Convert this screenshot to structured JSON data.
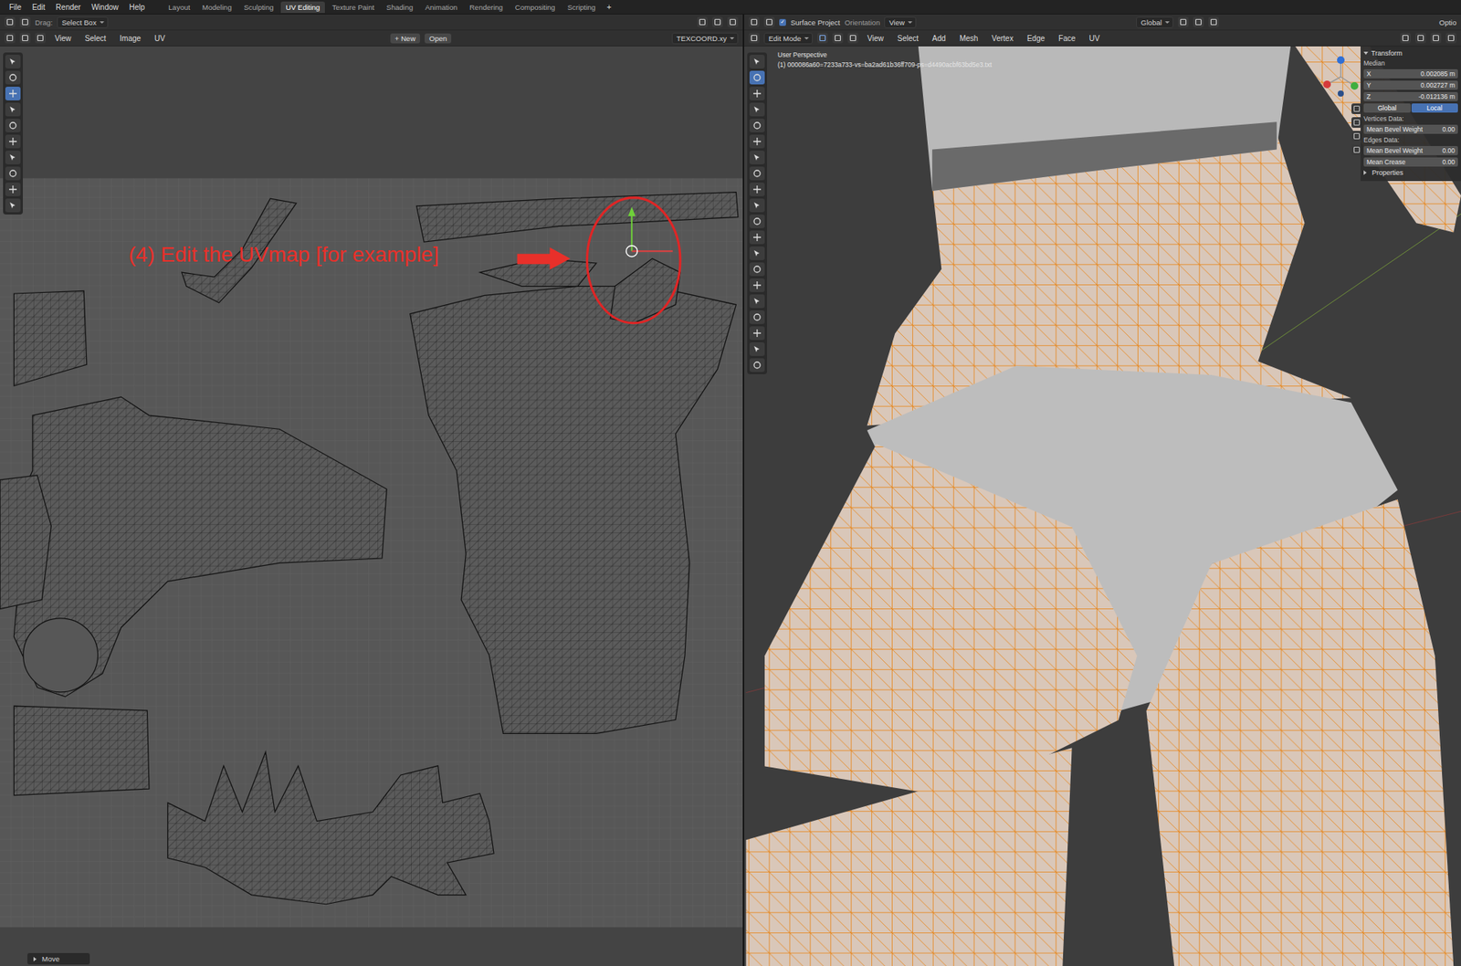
{
  "menubar": {
    "menus": [
      "File",
      "Edit",
      "Render",
      "Window",
      "Help"
    ],
    "workspaces": [
      {
        "label": "Layout",
        "selected": false
      },
      {
        "label": "Modeling",
        "selected": false
      },
      {
        "label": "Sculpting",
        "selected": false
      },
      {
        "label": "UV Editing",
        "selected": true
      },
      {
        "label": "Texture Paint",
        "selected": false
      },
      {
        "label": "Shading",
        "selected": false
      },
      {
        "label": "Animation",
        "selected": false
      },
      {
        "label": "Rendering",
        "selected": false
      },
      {
        "label": "Compositing",
        "selected": false
      },
      {
        "label": "Scripting",
        "selected": false
      }
    ],
    "add_tab": "+"
  },
  "uv_editor": {
    "drag_label": "Drag:",
    "drag_mode": "Select Box",
    "menus": [
      "View",
      "Select",
      "Image",
      "UV"
    ],
    "new_icon": "+",
    "new_button": "New",
    "open_button": "Open",
    "uv_map": "TEXCOORD.xy",
    "annotation": "(4) Edit the UVmap [for example]",
    "last_operator": "Move",
    "tools": [
      {
        "selected": false
      },
      {
        "selected": false
      },
      {
        "selected": true
      },
      {
        "selected": false
      },
      {
        "selected": false
      },
      {
        "selected": false
      },
      {
        "selected": false
      },
      {
        "selected": false
      },
      {
        "selected": false
      },
      {
        "selected": false
      }
    ]
  },
  "viewport": {
    "surface_project": {
      "label": "Surface Project",
      "checked": true
    },
    "orientation_label": "Orientation",
    "orientation": "View",
    "transform_orientation": "Global",
    "options": "Optio",
    "mode": "Edit Mode",
    "menus": [
      "View",
      "Select",
      "Add",
      "Mesh",
      "Vertex",
      "Edge",
      "Face",
      "UV"
    ],
    "overlay_title": "User Perspective",
    "overlay_object": "(1) 000086a60=7233a733-vs=ba2ad61b36ff709-ps=d4490acbf63bd5e3.txt",
    "tools": [
      {
        "selected": false
      },
      {
        "selected": true
      },
      {
        "selected": false
      },
      {
        "selected": false
      },
      {
        "selected": false
      },
      {
        "selected": false
      },
      {
        "selected": false
      },
      {
        "selected": false
      },
      {
        "selected": false
      },
      {
        "selected": false
      },
      {
        "selected": false
      },
      {
        "selected": false
      },
      {
        "selected": false
      },
      {
        "selected": false
      },
      {
        "selected": false
      },
      {
        "selected": false
      },
      {
        "selected": false
      },
      {
        "selected": false
      },
      {
        "selected": false
      },
      {
        "selected": false
      }
    ]
  },
  "n_panel": {
    "title": "Transform",
    "expanded": true,
    "median_label": "Median",
    "coords": [
      {
        "axis": "X",
        "value": "0.002085 m"
      },
      {
        "axis": "Y",
        "value": "0.002727 m"
      },
      {
        "axis": "Z",
        "value": "-0.012136 m"
      }
    ],
    "space": [
      {
        "label": "Global",
        "selected": false
      },
      {
        "label": "Local",
        "selected": true
      }
    ],
    "sections": [
      {
        "title": "Vertices Data:",
        "fields": [
          {
            "label": "Mean Bevel Weight",
            "value": "0.00"
          }
        ]
      },
      {
        "title": "Edges Data:",
        "fields": [
          {
            "label": "Mean Bevel Weight",
            "value": "0.00"
          },
          {
            "label": "Mean Crease",
            "value": "0.00"
          }
        ]
      }
    ],
    "properties": {
      "label": "Properties",
      "expanded": false
    }
  }
}
